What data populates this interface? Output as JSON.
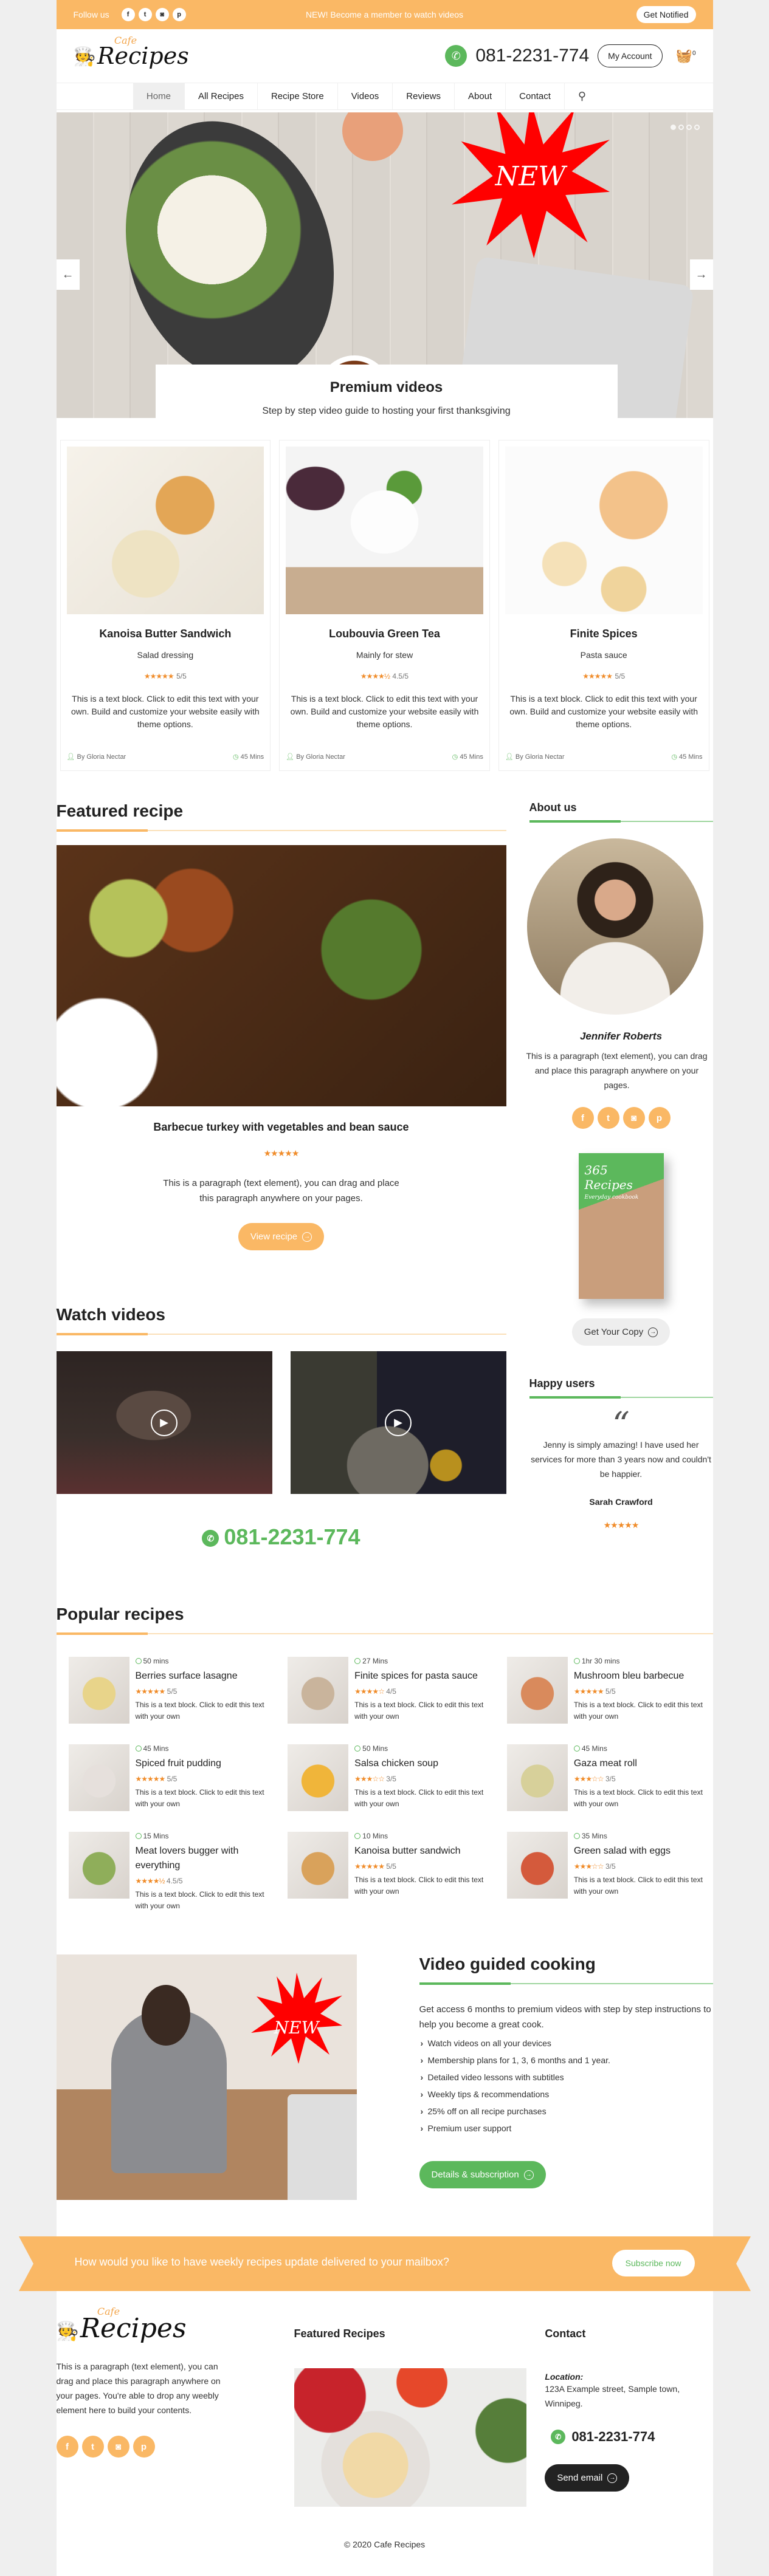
{
  "topbar": {
    "follow_label": "Follow us",
    "social": [
      {
        "icon": "facebook-icon",
        "glyph": "f"
      },
      {
        "icon": "twitter-icon",
        "glyph": "t"
      },
      {
        "icon": "instagram-icon",
        "glyph": "◙"
      },
      {
        "icon": "pinterest-icon",
        "glyph": "p"
      }
    ],
    "promo": "NEW! Become a member to watch videos",
    "notify_label": "Get Notified"
  },
  "header": {
    "logo_cafe": "Cafe",
    "logo_name": "Recipes",
    "phone": "081-2231-774",
    "account_label": "My Account",
    "cart_count": "0"
  },
  "nav": {
    "items": [
      "Home",
      "All Recipes",
      "Recipe Store",
      "Videos",
      "Reviews",
      "About",
      "Contact"
    ],
    "active": "Home"
  },
  "hero": {
    "badge": "NEW",
    "title": "Premium videos",
    "subtitle": "Step by step video guide to hosting your first thanksgiving",
    "slides_total": 4,
    "active_slide": 1
  },
  "cards": [
    {
      "title": "Kanoisa Butter Sandwich",
      "subtitle": "Salad dressing",
      "stars": "★★★★★",
      "rating": "5/5",
      "text": "This is a text block. Click to edit this text with your own. Build and customize your website easily with theme options.",
      "author": "By Gloria Nectar",
      "time": "45 Mins",
      "colors": [
        "#f4efe7",
        "#d9a25b",
        "#5b3a22"
      ]
    },
    {
      "title": "Loubouvia Green Tea",
      "subtitle": "Mainly for stew",
      "stars": "★★★★½",
      "rating": "4.5/5",
      "text": "This is a text block. Click to edit this text with your own. Build and customize your website easily with theme options.",
      "author": "By Gloria Nectar",
      "time": "45 Mins",
      "colors": [
        "#f3f3f3",
        "#e8e8e8",
        "#5c3d4a"
      ]
    },
    {
      "title": "Finite Spices",
      "subtitle": "Pasta sauce",
      "stars": "★★★★★",
      "rating": "5/5",
      "text": "This is a text block. Click to edit this text with your own. Build and customize your website easily with theme options.",
      "author": "By Gloria Nectar",
      "time": "45 Mins",
      "colors": [
        "#fbfbfb",
        "#f0c88a",
        "#c6466a"
      ]
    }
  ],
  "featured": {
    "heading": "Featured recipe",
    "title": "Barbecue turkey with vegetables and bean sauce",
    "stars": "★★★★★",
    "text": "This is a paragraph (text element), you can drag and place this paragraph anywhere on your pages.",
    "button": "View recipe"
  },
  "about": {
    "heading": "About us",
    "name": "Jennifer Roberts",
    "text": "This is a paragraph (text element), you can drag and place this paragraph anywhere on your pages.",
    "book_title": "365 Recipes",
    "book_sub": "Everyday cookbook",
    "button": "Get Your Copy"
  },
  "watch": {
    "heading": "Watch videos",
    "videos": [
      {
        "label": "video-1"
      },
      {
        "label": "video-2"
      }
    ],
    "phone": "081-2231-774"
  },
  "happy": {
    "heading": "Happy users",
    "quote_mark": "“",
    "text": "Jenny is simply amazing! I have used her services for more than 3 years now and couldn't be happier.",
    "name": "Sarah Crawford",
    "stars": "★★★★★"
  },
  "popular": {
    "heading": "Popular recipes",
    "items": [
      {
        "time": "50 mins",
        "name": "Berries surface lasagne",
        "stars": "★★★★★",
        "rating": "5/5",
        "text": "This is a text block. Click to edit this text with your own",
        "color": "#e8d48a"
      },
      {
        "time": "27 Mins",
        "name": "Finite spices for pasta sauce",
        "stars": "★★★★☆",
        "rating": "4/5",
        "text": "This is a text block. Click to edit this text with your own",
        "color": "#c9b49c"
      },
      {
        "time": "1hr 30 mins",
        "name": "Mushroom bleu barbecue",
        "stars": "★★★★★",
        "rating": "5/5",
        "text": "This is a text block. Click to edit this text with your own",
        "color": "#d98a5c"
      },
      {
        "time": "45 Mins",
        "name": "Spiced fruit pudding",
        "stars": "★★★★★",
        "rating": "5/5",
        "text": "This is a text block. Click to edit this text with your own",
        "color": "#e6e0dc"
      },
      {
        "time": "50 Mins",
        "name": "Salsa chicken soup",
        "stars": "★★★☆☆",
        "rating": "3/5",
        "text": "This is a text block. Click to edit this text with your own",
        "color": "#f0b53a"
      },
      {
        "time": "45 Mins",
        "name": "Gaza meat roll",
        "stars": "★★★☆☆",
        "rating": "3/5",
        "text": "This is a text block. Click to edit this text with your own",
        "color": "#d7d09a"
      },
      {
        "time": "15 Mins",
        "name": "Meat lovers bugger with everything",
        "stars": "★★★★½",
        "rating": "4.5/5",
        "text": "This is a text block. Click to edit this text with your own",
        "color": "#8fae5a"
      },
      {
        "time": "10 Mins",
        "name": "Kanoisa butter sandwich",
        "stars": "★★★★★",
        "rating": "5/5",
        "text": "This is a text block. Click to edit this text with your own",
        "color": "#d9a25b"
      },
      {
        "time": "35 Mins",
        "name": "Green salad with eggs",
        "stars": "★★★☆☆",
        "rating": "3/5",
        "text": "This is a text block. Click to edit this text with your own",
        "color": "#d45a3c"
      }
    ]
  },
  "vgc": {
    "badge": "NEW",
    "heading": "Video guided cooking",
    "intro": "Get access 6 months to premium videos with step by step instructions to help you become a great cook.",
    "bullets": [
      "Watch videos on all your devices",
      "Membership plans for 1, 3, 6 months and 1 year.",
      "Detailed video lessons with subtitles",
      "Weekly tips & recommendations",
      "25% off on all recipe purchases",
      "Premium user support"
    ],
    "button": "Details & subscription"
  },
  "ribbon": {
    "text": "How would you like to have weekly recipes update delivered to your mailbox?",
    "button": "Subscribe now"
  },
  "footer": {
    "logo_cafe": "Cafe",
    "logo_name": "Recipes",
    "about": "This is a paragraph (text element), you can drag and place this paragraph anywhere on your pages. You're able to drop any weebly element here to build your contents.",
    "featured_heading": "Featured Recipes",
    "contact_heading": "Contact",
    "location_label": "Location:",
    "address": "123A Example street,  Sample town, Winnipeg.",
    "phone": "081-2231-774",
    "email_button": "Send email",
    "copyright": "© 2020 Cafe Recipes"
  },
  "colors": {
    "accent_orange": "#fab865",
    "accent_green": "#5cb85c",
    "star_orange": "#f08c2a",
    "badge_red": "#ff0000"
  }
}
